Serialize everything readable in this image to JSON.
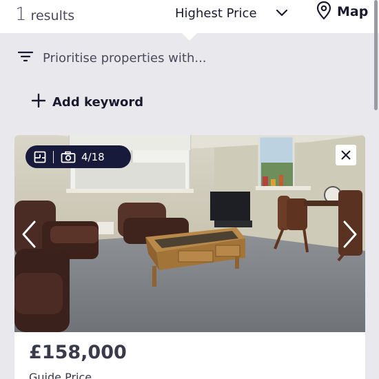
{
  "header": {
    "results_count": "1",
    "results_label": "results",
    "sort_label": "Highest Price",
    "map_label": "Map"
  },
  "filters": {
    "prioritise_label": "Prioritise properties with...",
    "add_keyword_label": "Add keyword"
  },
  "listing": {
    "photo_counter": "4/18",
    "price": "£158,000",
    "price_qualifier": "Guide Price"
  },
  "icons": {
    "sort": "chevron-down-icon",
    "map": "map-pin-icon",
    "filter": "filter-lines-icon",
    "add": "plus-icon",
    "floorplan": "floorplan-icon",
    "camera": "camera-icon",
    "close": "close-icon",
    "prev": "chevron-left-icon",
    "next": "chevron-right-icon"
  },
  "colors": {
    "badge_bg": "#181a3c",
    "page_bg": "#e9e9ed",
    "text_primary": "#1a1a2e"
  }
}
